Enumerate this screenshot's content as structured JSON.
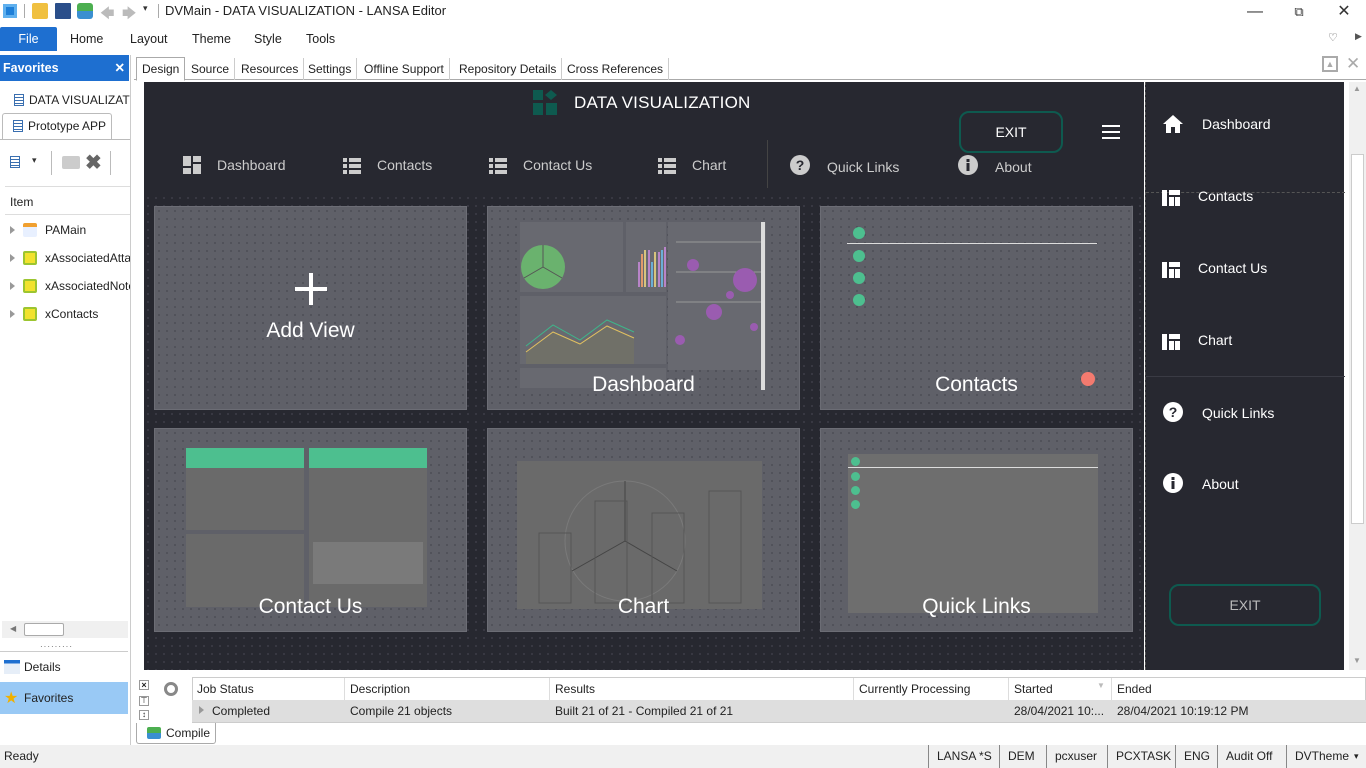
{
  "window": {
    "title": "DVMain - DATA VISUALIZATION - LANSA Editor",
    "minimize_icon": "minimize-icon",
    "restore_icon": "restore-icon",
    "close_icon": "close-icon"
  },
  "ribbon": {
    "tabs": [
      "File",
      "Home",
      "Layout",
      "Theme",
      "Style",
      "Tools"
    ]
  },
  "favorites": {
    "title": "Favorites",
    "items": [
      "DATA VISUALIZATION",
      "Prototype APP"
    ],
    "column_header": "Item",
    "tree": [
      "PAMain",
      "xAssociatedAttachments",
      "xAssociatedNotes",
      "xContacts"
    ]
  },
  "left_bottom": {
    "details": "Details",
    "favorites": "Favorites"
  },
  "doc_tabs": [
    "Design",
    "Source",
    "Resources",
    "Settings",
    "Offline Support",
    "Repository Details",
    "Cross References"
  ],
  "app": {
    "title": "DATA VISUALIZATION",
    "exit_label": "EXIT",
    "nav": [
      {
        "label": "Dashboard",
        "icon": "dashboard-icon"
      },
      {
        "label": "Contacts",
        "icon": "list-icon"
      },
      {
        "label": "Contact Us",
        "icon": "list-icon"
      },
      {
        "label": "Chart",
        "icon": "list-icon"
      },
      {
        "label": "Quick Links",
        "icon": "help-icon"
      },
      {
        "label": "About",
        "icon": "info-icon"
      }
    ],
    "tiles": [
      {
        "label": "Add View"
      },
      {
        "label": "Dashboard"
      },
      {
        "label": "Contacts"
      },
      {
        "label": "Contact Us"
      },
      {
        "label": "Chart"
      },
      {
        "label": "Quick Links"
      }
    ],
    "drawer": [
      {
        "label": "Dashboard",
        "icon": "home-icon"
      },
      {
        "label": "Contacts",
        "icon": "grid-icon"
      },
      {
        "label": "Contact Us",
        "icon": "grid-icon"
      },
      {
        "label": "Chart",
        "icon": "grid-icon"
      },
      {
        "label": "Quick Links",
        "icon": "help-icon"
      },
      {
        "label": "About",
        "icon": "info-icon"
      }
    ],
    "drawer_exit": "EXIT",
    "accent_color": "#0e5a4f",
    "green_color": "#4dbf8f"
  },
  "jobs": {
    "columns": [
      "Job Status",
      "Description",
      "Results",
      "Currently Processing",
      "Started",
      "Ended"
    ],
    "rows": [
      {
        "status": "Completed",
        "description": "Compile 21 objects",
        "results": "Built 21 of 21 - Compiled 21 of 21",
        "processing": "",
        "started": "28/04/2021 10:...",
        "ended": "28/04/2021 10:19:12 PM"
      }
    ],
    "tab_label": "Compile"
  },
  "statusbar": {
    "ready": "Ready",
    "items": [
      "LANSA *S",
      "DEM",
      "pcxuser",
      "PCXTASK",
      "ENG",
      "Audit Off",
      "DVTheme"
    ]
  }
}
